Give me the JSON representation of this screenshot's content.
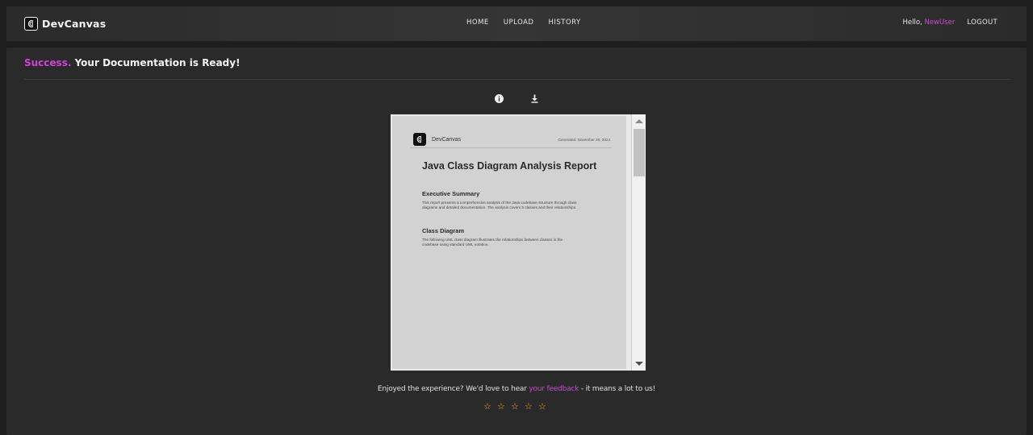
{
  "nav": {
    "brand": "DevCanvas",
    "links": [
      "HOME",
      "UPLOAD",
      "HISTORY"
    ],
    "greeting": "Hello,",
    "username": "NewUser",
    "logout": "LOGOUT"
  },
  "main": {
    "headline_accent": "Success.",
    "headline_rest": "Your Documentation is Ready!",
    "actions": {
      "info_icon": "info-icon",
      "download_icon": "download-icon"
    }
  },
  "document": {
    "brand": "DevCanvas",
    "generated": "Generated: November 20, 2024",
    "title": "Java Class Diagram Analysis Report",
    "sections": [
      {
        "heading": "Executive Summary",
        "lines": [
          "This report presents a comprehensive analysis of the Java codebase structure through class",
          "diagrams and detailed documentation. The analysis covers 5 classes and their relationships."
        ]
      },
      {
        "heading": "Class Diagram",
        "lines": [
          "The following UML class diagram illustrates the relationships between classes in the",
          "codebase using standard UML notation."
        ]
      }
    ]
  },
  "feedback": {
    "before": "Enjoyed the experience? We'd love to hear ",
    "link": "your feedback",
    "after": " - it means a lot to us!",
    "rating_value": 0,
    "rating_max": 5,
    "star_glyph": "☆"
  },
  "colors": {
    "accent": "#d33fdd",
    "star": "#e5b22a",
    "background": "#1e1e1e",
    "panel": "#2a2a2a"
  }
}
